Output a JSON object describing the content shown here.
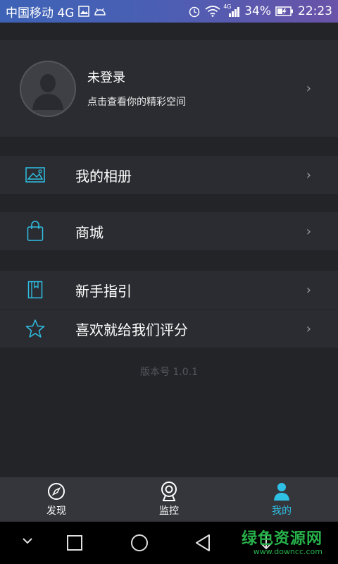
{
  "status_bar": {
    "carrier": "中国移动 4G",
    "signal_tech": "4G",
    "battery": "34%",
    "time": "22:23"
  },
  "profile": {
    "name": "未登录",
    "subtitle": "点击查看你的精彩空间",
    "chevron": "›"
  },
  "menu": {
    "items": [
      {
        "label": "我的相册",
        "icon": "album-icon"
      },
      {
        "label": "商城",
        "icon": "shopping-bag-icon"
      },
      {
        "label": "新手指引",
        "icon": "book-icon"
      },
      {
        "label": "喜欢就给我们评分",
        "icon": "star-icon"
      }
    ],
    "chevron": "›"
  },
  "version": "版本号 1.0.1",
  "tabs": [
    {
      "label": "发现",
      "icon": "compass-icon",
      "active": false
    },
    {
      "label": "监控",
      "icon": "webcam-icon",
      "active": false
    },
    {
      "label": "我的",
      "icon": "person-icon",
      "active": true
    }
  ],
  "watermark": {
    "main": "绿色资源网",
    "sub": "www.downcc.com"
  },
  "colors": {
    "accent": "#2fc0e6",
    "background": "#232428",
    "row": "#2b2c31",
    "tabbar": "#35363b"
  }
}
